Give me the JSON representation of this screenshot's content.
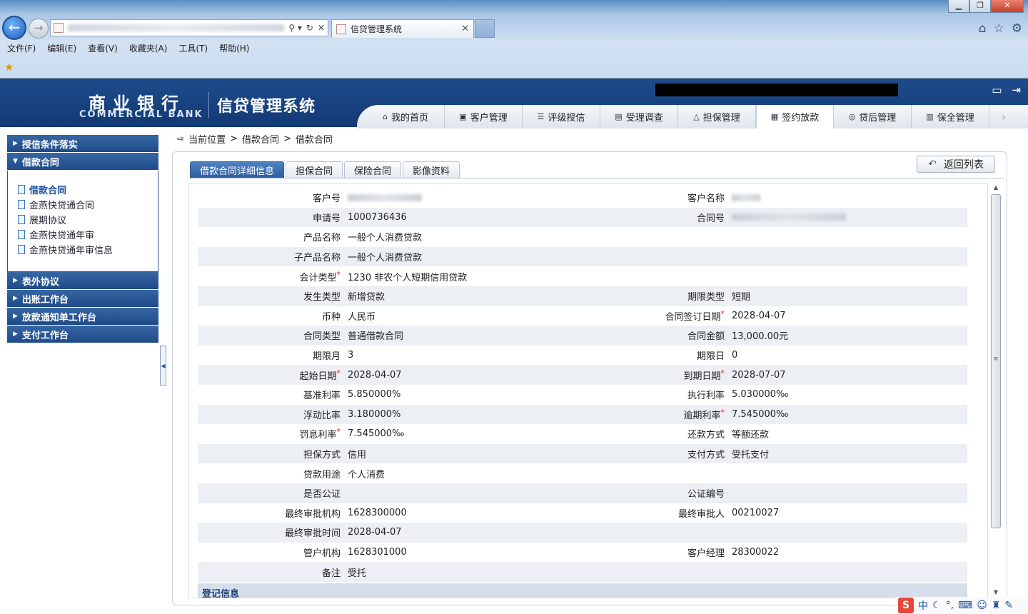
{
  "browser": {
    "tab_title": "信贷管理系统",
    "menu": [
      "文件(F)",
      "编辑(E)",
      "查看(V)",
      "收藏夹(A)",
      "工具(T)",
      "帮助(H)"
    ]
  },
  "header": {
    "bank_cn": "商业银行",
    "bank_en": "COMMERCIAL BANK",
    "system_name": "信贷管理系统",
    "nav": [
      "我的首页",
      "客户管理",
      "评级授信",
      "受理调查",
      "担保管理",
      "签约放款",
      "贷后管理",
      "保全管理"
    ],
    "active_nav": "签约放款"
  },
  "sidebar": {
    "sections": [
      {
        "label": "授信条件落实"
      },
      {
        "label": "借款合同",
        "items": [
          "借款合同",
          "金燕快贷通合同",
          "展期协议",
          "金燕快贷通年审",
          "金燕快贷通年审信息"
        ]
      },
      {
        "label": "表外协议"
      },
      {
        "label": "出账工作台"
      },
      {
        "label": "放款通知单工作台"
      },
      {
        "label": "支付工作台"
      }
    ]
  },
  "breadcrumb": {
    "prefix": "当前位置",
    "sep": ">",
    "level1": "借款合同",
    "level2": "借款合同"
  },
  "tabs": [
    "借款合同详细信息",
    "担保合同",
    "保险合同",
    "影像资料"
  ],
  "back_button": "返回列表",
  "form": {
    "rows": [
      {
        "l1": "客户号",
        "v1": "",
        "l2": "客户名称",
        "v2": ""
      },
      {
        "l1": "申请号",
        "v1": "1000736436",
        "l2": "合同号",
        "v2": ""
      },
      {
        "l1": "产品名称",
        "v1": "一般个人消费贷款",
        "l2": "",
        "v2": ""
      },
      {
        "l1": "子产品名称",
        "v1": "一般个人消费贷款",
        "l2": "",
        "v2": ""
      },
      {
        "l1": "会计类型",
        "v1": "1230 非农个人短期信用贷款",
        "l2": "",
        "v2": ""
      },
      {
        "l1": "发生类型",
        "v1": "新增贷款",
        "l2": "期限类型",
        "v2": "短期"
      },
      {
        "l1": "币种",
        "v1": "人民币",
        "l2": "合同签订日期",
        "v2": "2028-04-07"
      },
      {
        "l1": "合同类型",
        "v1": "普通借款合同",
        "l2": "合同金额",
        "v2": "13,000.00元"
      },
      {
        "l1": "期限月",
        "v1": "3",
        "l2": "期限日",
        "v2": "0"
      },
      {
        "l1": "起始日期",
        "v1": "2028-04-07",
        "l2": "到期日期",
        "v2": "2028-07-07"
      },
      {
        "l1": "基准利率",
        "v1": "5.850000%",
        "l2": "执行利率",
        "v2": "5.030000‰"
      },
      {
        "l1": "浮动比率",
        "v1": "3.180000%",
        "l2": "逾期利率",
        "v2": "7.545000‰"
      },
      {
        "l1": "罚息利率",
        "v1": "7.545000‰",
        "l2": "还款方式",
        "v2": "等额还款"
      },
      {
        "l1": "担保方式",
        "v1": "信用",
        "l2": "支付方式",
        "v2": "受托支付"
      },
      {
        "l1": "贷款用途",
        "v1": "个人消费",
        "l2": "",
        "v2": ""
      },
      {
        "l1": "是否公证",
        "v1": "",
        "l2": "公证编号",
        "v2": ""
      },
      {
        "l1": "最终审批机构",
        "v1": "1628300000",
        "l2": "最终审批人",
        "v2": "00210027"
      },
      {
        "l1": "最终审批时间",
        "v1": "2028-04-07",
        "l2": "",
        "v2": ""
      },
      {
        "l1": "管户机构",
        "v1": "1628301000",
        "l2": "客户经理",
        "v2": "28300022"
      },
      {
        "l1": "备注",
        "v1": "受托",
        "l2": "",
        "v2": ""
      }
    ],
    "required_marker": "*",
    "section_title": "登记信息"
  },
  "ime": {
    "logo": "S",
    "mode": "中"
  }
}
